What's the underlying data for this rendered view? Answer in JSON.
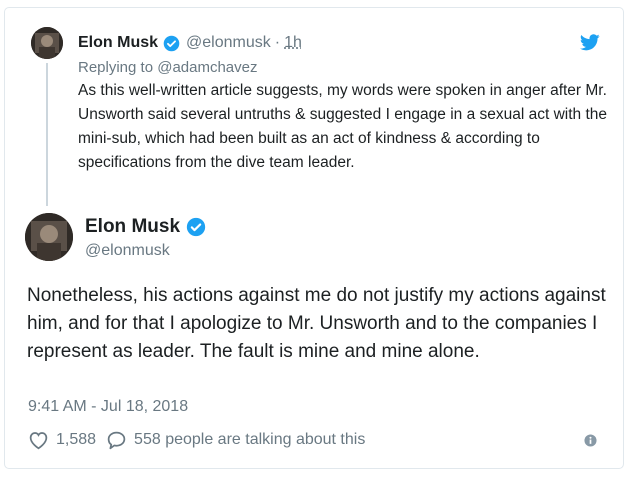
{
  "parent_tweet": {
    "author_name": "Elon Musk",
    "author_handle": "@elonmusk",
    "separator": "·",
    "time": "1h",
    "reply_context": "Replying to @adamchavez",
    "text": "As this well-written article suggests, my words were spoken in anger after Mr. Unsworth said several untruths & suggested I engage in a sexual act with the mini-sub, which had been built as an act of kindness & according to specifications from the dive team leader."
  },
  "main_tweet": {
    "author_name": "Elon Musk",
    "author_handle": "@elonmusk",
    "text": "Nonetheless, his actions against me do not justify my actions against him, and for that I apologize to Mr. Unsworth and to the companies I represent as leader. The fault is mine and mine alone.",
    "timestamp": "9:41 AM - Jul 18, 2018"
  },
  "actions": {
    "like_count": "1,588",
    "talking_text": "558 people are talking about this"
  },
  "icons": {
    "twitter": "twitter-bird-icon",
    "verified": "verified-badge-icon",
    "like": "heart-icon",
    "reply": "speech-bubble-icon",
    "info": "info-icon"
  },
  "colors": {
    "twitter_blue": "#1da1f2",
    "text": "#1c2022",
    "muted": "#697882",
    "border": "#e1e8ed"
  }
}
